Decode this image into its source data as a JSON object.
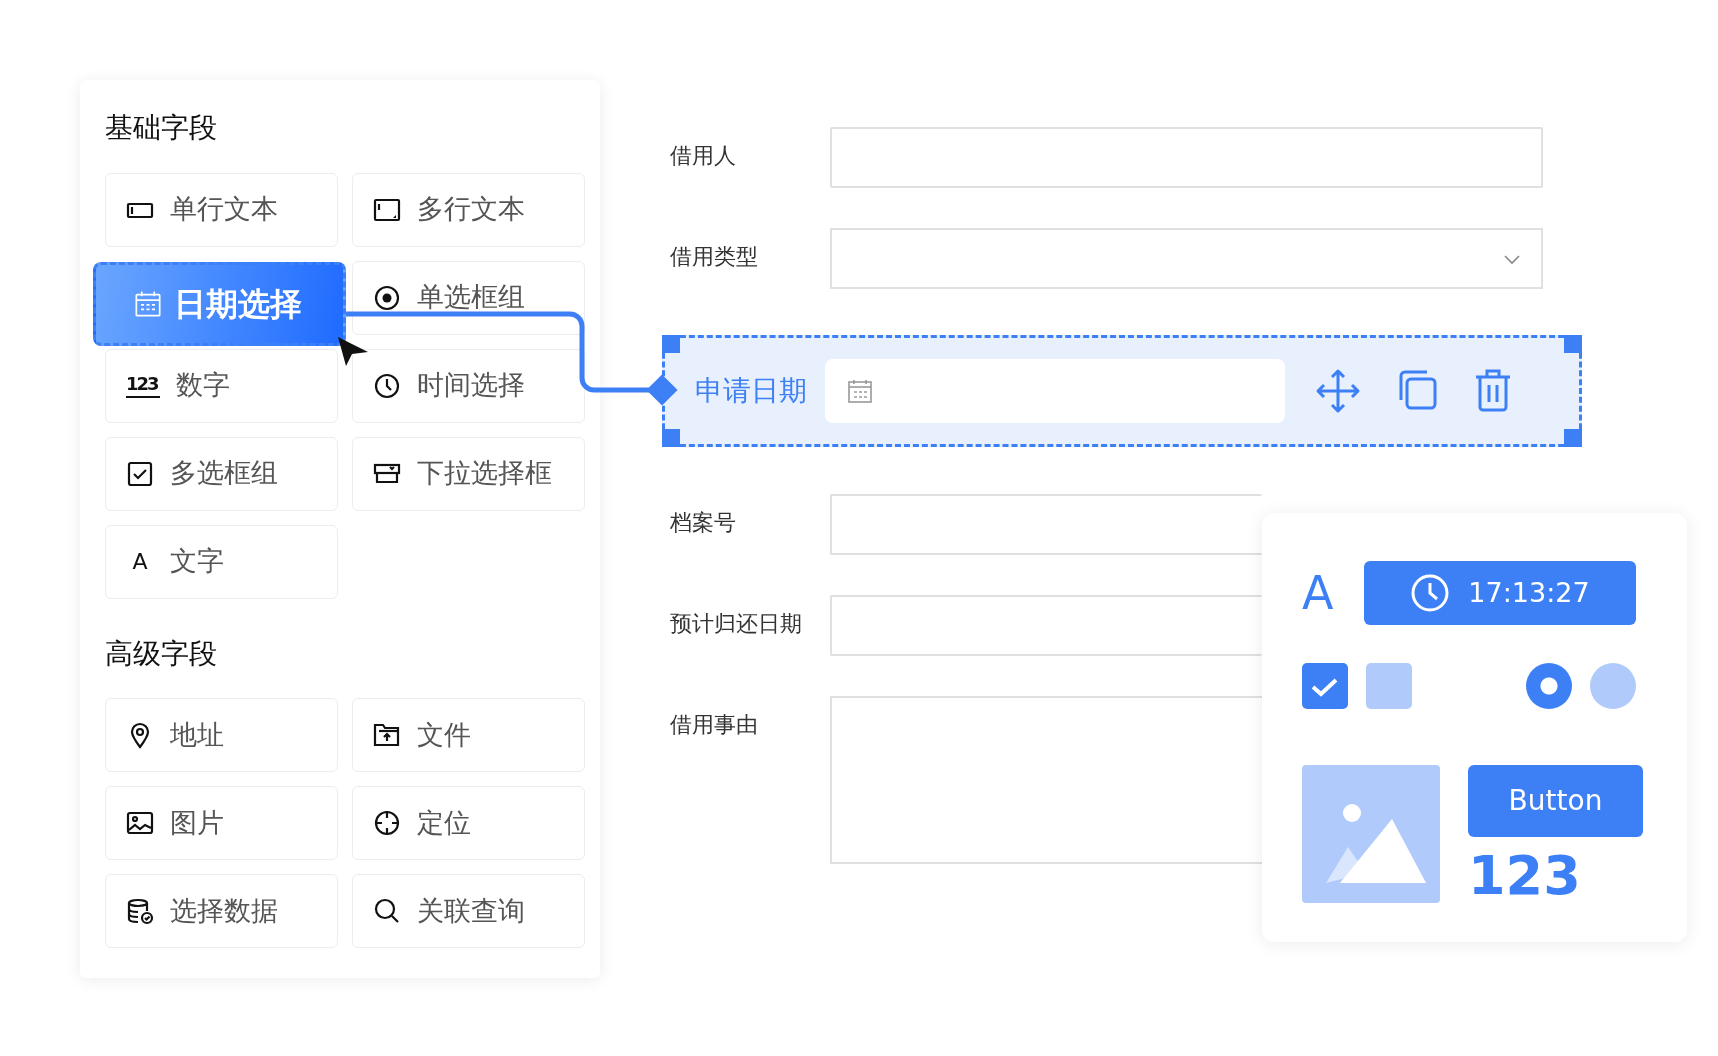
{
  "basic_fields": {
    "title": "基础字段",
    "items": [
      {
        "label": "单行文本",
        "dragging": false
      },
      {
        "label": "多行文本",
        "dragging": false
      },
      {
        "label": "日期选择",
        "dragging": true
      },
      {
        "label": "单选框组",
        "dragging": false
      },
      {
        "label": "数字",
        "glyph": "123",
        "dragging": false
      },
      {
        "label": "时间选择",
        "dragging": false
      },
      {
        "label": "多选框组",
        "dragging": false
      },
      {
        "label": "下拉选择框",
        "dragging": false
      },
      {
        "label": "文字",
        "glyph": "A",
        "dragging": false
      }
    ]
  },
  "advanced_fields": {
    "title": "高级字段",
    "items": [
      {
        "label": "地址",
        "dragging": false
      },
      {
        "label": "文件",
        "dragging": false
      },
      {
        "label": "图片",
        "dragging": false
      },
      {
        "label": "定位",
        "dragging": false
      },
      {
        "label": "选择数据",
        "dragging": false
      },
      {
        "label": "关联查询",
        "dragging": false
      }
    ]
  },
  "form_fields": [
    {
      "label": "借用人",
      "kind": "text",
      "selected": false
    },
    {
      "label": "借用类型",
      "kind": "select",
      "selected": false
    },
    {
      "label": "申请日期",
      "kind": "date",
      "selected": true
    },
    {
      "label": "档案号",
      "kind": "text",
      "selected": false
    },
    {
      "label": "预计归还日期",
      "kind": "text",
      "selected": false
    },
    {
      "label": "借用事由",
      "kind": "textarea",
      "selected": false
    }
  ],
  "widget_preview": {
    "letter": "A",
    "time": "17:13:27",
    "checkboxes": [
      {
        "checked": true
      },
      {
        "checked": false
      }
    ],
    "radios": [
      {
        "selected": true
      },
      {
        "selected": false
      }
    ],
    "button": "Button",
    "number": "123"
  }
}
